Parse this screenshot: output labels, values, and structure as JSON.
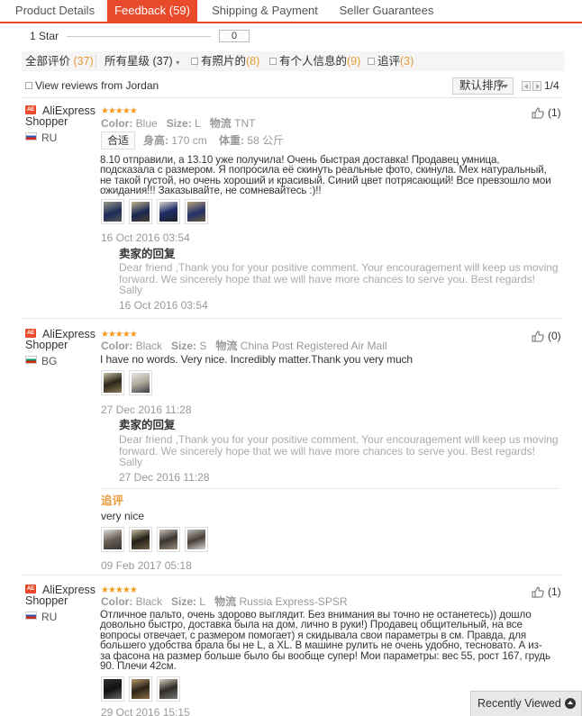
{
  "tabs": [
    {
      "label": "Product Details"
    },
    {
      "label": "Feedback (59)"
    },
    {
      "label": "Shipping & Payment"
    },
    {
      "label": "Seller Guarantees"
    }
  ],
  "star_filter": {
    "label": "1 Star",
    "count": "0"
  },
  "filters": {
    "all": {
      "label": "全部评价",
      "count": "(37)"
    },
    "stars": {
      "label": "所有星级 (37)"
    },
    "photos": {
      "label": "有照片的",
      "count": "(8)"
    },
    "personal": {
      "label": "有个人信息的",
      "count": "(9)"
    },
    "followup": {
      "label": "追评",
      "count": "(3)"
    }
  },
  "jordan_label": "View reviews from Jordan",
  "sort": {
    "label": "默认排序"
  },
  "pagination": {
    "text": "1/4"
  },
  "colors": {
    "accent": "#e94a2b",
    "star": "#f29b1e",
    "followup": "#e79b3b"
  },
  "reviews": [
    {
      "user": "AliExpress Shopper",
      "badge": "AE",
      "country": "RU",
      "stars": "★★★★★",
      "meta": {
        "color_label": "Color:",
        "color": "Blue",
        "size_label": "Size:",
        "size": "L",
        "ship_label": "物流",
        "ship": "TNT"
      },
      "fit": "合适",
      "height_label": "身高:",
      "height": "170 cm",
      "weight_label": "体重:",
      "weight": "58 公斤",
      "text": "8.10 отправили, а 13.10 уже получила! Очень быстрая доставка! Продавец умница, подсказала с размером. Я попросила её скинуть реальные фото, скинула. Мех натуральный, не такой густой, но очень хороший и красивый. Синий цвет потрясающий! Все превзошло мои ожидания!!! Заказывайте, не сомневайтесь :)!!",
      "date": "16 Oct 2016 03:54",
      "helpful": "(1)",
      "reply": {
        "title": "卖家的回复",
        "text": "Dear friend ,Thank you for your positive comment. Your encouragement will keep us moving forward. We sincerely hope that we will have more chances to serve you. Best regards! Sally",
        "date": "16 Oct 2016 03:54"
      }
    },
    {
      "user": "AliExpress Shopper",
      "badge": "AE",
      "country": "BG",
      "stars": "★★★★★",
      "meta": {
        "color_label": "Color:",
        "color": "Black",
        "size_label": "Size:",
        "size": "S",
        "ship_label": "物流",
        "ship": "China Post Registered Air Mail"
      },
      "text": "I have no words. Very nice. Incredibly matter.Thank you very much",
      "date": "27 Dec 2016 11:28",
      "helpful": "(0)",
      "reply": {
        "title": "卖家的回复",
        "text": "Dear friend ,Thank you for your positive comment. Your encouragement will keep us moving forward. We sincerely hope that we will have more chances to serve you. Best regards! Sally",
        "date": "27 Dec 2016 11:28"
      },
      "additional": {
        "title": "追评",
        "text": "very nice",
        "date": "09 Feb 2017 05:18"
      }
    },
    {
      "user": "AliExpress Shopper",
      "badge": "AE",
      "country": "RU",
      "stars": "★★★★★",
      "meta": {
        "color_label": "Color:",
        "color": "Black",
        "size_label": "Size:",
        "size": "L",
        "ship_label": "物流",
        "ship": "Russia Express-SPSR"
      },
      "text": "Отличное пальто, очень здорово выглядит. Без внимания вы точно не останетесь)) дошло довольно быстро, доставка была на дом, лично в руки!) Продавец общительный, на все вопросы отвечает, с размером помогает) я скидывала свои параметры в см. Правда, для большего удобства брала бы не L, а XL. В машине рулить не очень удобно, тесновато. А из-за фасона на размер больше было бы вообще супер! Мои параметры: вес 55, рост 167, грудь 90. Плечи 42см.",
      "date": "29 Oct 2016 15:15",
      "helpful": "(1)"
    }
  ],
  "recently_viewed": "Recently Viewed"
}
